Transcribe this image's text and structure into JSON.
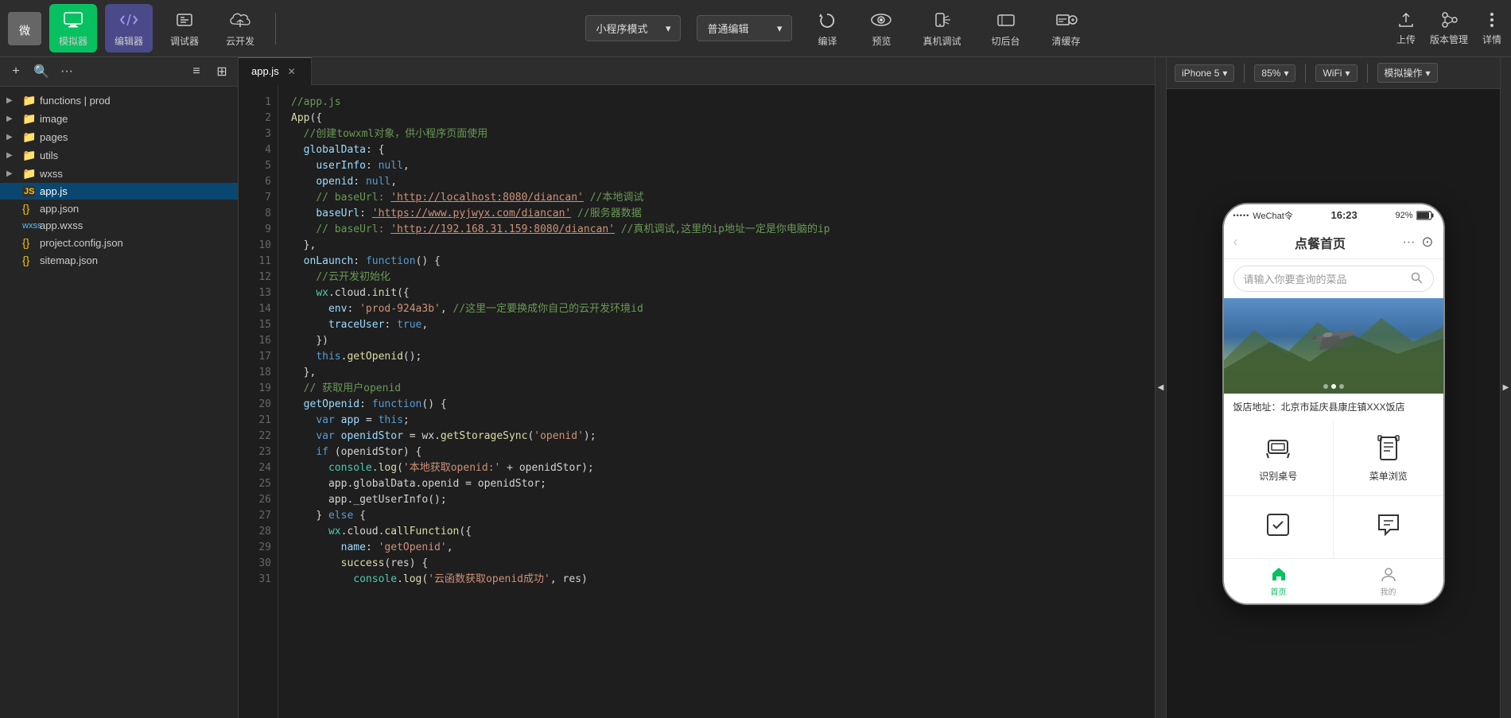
{
  "toolbar": {
    "logo_alt": "WeChat DevTools",
    "simulator_label": "模拟器",
    "editor_label": "编辑器",
    "debugger_label": "调试器",
    "cloud_label": "云开发",
    "miniprogram_mode_label": "小程序模式",
    "miniprogram_mode_value": "小程序模式",
    "translate_label": "普通编辑",
    "translate_value": "普通编辑",
    "compile_label": "编译",
    "preview_label": "预览",
    "real_debug_label": "真机调试",
    "backend_label": "切后台",
    "clear_cache_label": "清缓存",
    "upload_label": "上传",
    "version_label": "版本管理",
    "detail_label": "详情"
  },
  "sidebar": {
    "add_btn": "+",
    "search_btn": "🔍",
    "more_btn": "···",
    "list_btn": "≡",
    "expand_btn": "⊞",
    "items": [
      {
        "id": "functions",
        "label": "functions | prod",
        "type": "folder",
        "expanded": true,
        "indent": 0
      },
      {
        "id": "image",
        "label": "image",
        "type": "folder",
        "expanded": false,
        "indent": 0
      },
      {
        "id": "pages",
        "label": "pages",
        "type": "folder",
        "expanded": false,
        "indent": 0
      },
      {
        "id": "utils",
        "label": "utils",
        "type": "folder",
        "expanded": false,
        "indent": 0
      },
      {
        "id": "wxss",
        "label": "wxss",
        "type": "folder",
        "expanded": false,
        "indent": 0
      },
      {
        "id": "app_js",
        "label": "app.js",
        "type": "js",
        "expanded": false,
        "indent": 0,
        "active": true
      },
      {
        "id": "app_json",
        "label": "app.json",
        "type": "json",
        "expanded": false,
        "indent": 0
      },
      {
        "id": "app_wxss",
        "label": "app.wxss",
        "type": "wxss",
        "expanded": false,
        "indent": 0
      },
      {
        "id": "project_config",
        "label": "project.config.json",
        "type": "json",
        "expanded": false,
        "indent": 0
      },
      {
        "id": "sitemap",
        "label": "sitemap.json",
        "type": "json",
        "expanded": false,
        "indent": 0
      }
    ]
  },
  "editor": {
    "tab_name": "app.js",
    "lines": [
      {
        "num": 1,
        "text": "//app.js",
        "type": "comment"
      },
      {
        "num": 2,
        "text": "App({",
        "type": "code"
      },
      {
        "num": 3,
        "text": "  //创建towxml对象，供小程序页面使用",
        "type": "comment"
      },
      {
        "num": 4,
        "text": "  globalData: {",
        "type": "code"
      },
      {
        "num": 5,
        "text": "    userInfo: null,",
        "type": "code"
      },
      {
        "num": 6,
        "text": "    openid: null,",
        "type": "code"
      },
      {
        "num": 7,
        "text": "    // baseUrl: 'http://localhost:8080/diancan' //本地调试",
        "type": "comment_url",
        "url": "http://localhost:8080/diancan"
      },
      {
        "num": 8,
        "text": "    baseUrl: 'https://www.pyjwyx.com/diancan' //服务器数据",
        "type": "url_line",
        "url": "https://www.pyjwyx.com/diancan"
      },
      {
        "num": 9,
        "text": "    // baseUrl: 'http://192.168.31.159:8080/diancan' //真机调试,这里的ip地址一定是你电脑的ip",
        "type": "comment_url",
        "url": "http://192.168.31.159:8080/diancan"
      },
      {
        "num": 10,
        "text": "  },",
        "type": "code"
      },
      {
        "num": 11,
        "text": "  onLaunch: function() {",
        "type": "code"
      },
      {
        "num": 12,
        "text": "    //云开发初始化",
        "type": "comment"
      },
      {
        "num": 13,
        "text": "    wx.cloud.init({",
        "type": "code"
      },
      {
        "num": 14,
        "text": "      env: 'prod-924a3b', //这里一定要换成你自己的云开发环境id",
        "type": "code_comment"
      },
      {
        "num": 15,
        "text": "      traceUser: true,",
        "type": "code"
      },
      {
        "num": 16,
        "text": "    })",
        "type": "code"
      },
      {
        "num": 17,
        "text": "    this.getOpenid();",
        "type": "code"
      },
      {
        "num": 18,
        "text": "  },",
        "type": "code"
      },
      {
        "num": 19,
        "text": "  // 获取用户openid",
        "type": "comment"
      },
      {
        "num": 20,
        "text": "  getOpenid: function() {",
        "type": "code"
      },
      {
        "num": 21,
        "text": "    var app = this;",
        "type": "code"
      },
      {
        "num": 22,
        "text": "    var openidStor = wx.getStorageSync('openid');",
        "type": "code"
      },
      {
        "num": 23,
        "text": "    if (openidStor) {",
        "type": "code"
      },
      {
        "num": 24,
        "text": "      console.log('本地获取openid:' + openidStor);",
        "type": "code_cn"
      },
      {
        "num": 25,
        "text": "      app.globalData.openid = openidStor;",
        "type": "code"
      },
      {
        "num": 26,
        "text": "      app._getUserInfo();",
        "type": "code"
      },
      {
        "num": 27,
        "text": "    } else {",
        "type": "code"
      },
      {
        "num": 28,
        "text": "      wx.cloud.callFunction({",
        "type": "code"
      },
      {
        "num": 29,
        "text": "        name: 'getOpenid',",
        "type": "code"
      },
      {
        "num": 30,
        "text": "        success(res) {",
        "type": "code"
      },
      {
        "num": 31,
        "text": "          console.log('云函数获取openid成功', res)",
        "type": "code_cn"
      }
    ]
  },
  "preview": {
    "device_label": "iPhone 5",
    "zoom_label": "85%",
    "network_label": "WiFi",
    "simulate_label": "模拟操作",
    "collapse_left": "◀",
    "collapse_right": "▶",
    "phone": {
      "signal": "•••••",
      "carrier": "WeChat令",
      "time": "16:23",
      "battery": "92%",
      "nav_title": "点餐首页",
      "more_icon": "···",
      "camera_icon": "⊙",
      "search_placeholder": "请输入你要查询的菜品",
      "address": "饭店地址：北京市延庆县康庄镇XXX饭店",
      "menu_items": [
        {
          "icon": "🍽",
          "label": "识别桌号"
        },
        {
          "icon": "🛍",
          "label": "菜单浏览"
        },
        {
          "icon": "✉",
          "label": ""
        },
        {
          "icon": "💬",
          "label": ""
        }
      ],
      "bottom_nav": [
        {
          "icon": "🏠",
          "label": "首页",
          "active": true
        },
        {
          "icon": "👤",
          "label": "我的",
          "active": false
        }
      ]
    }
  }
}
